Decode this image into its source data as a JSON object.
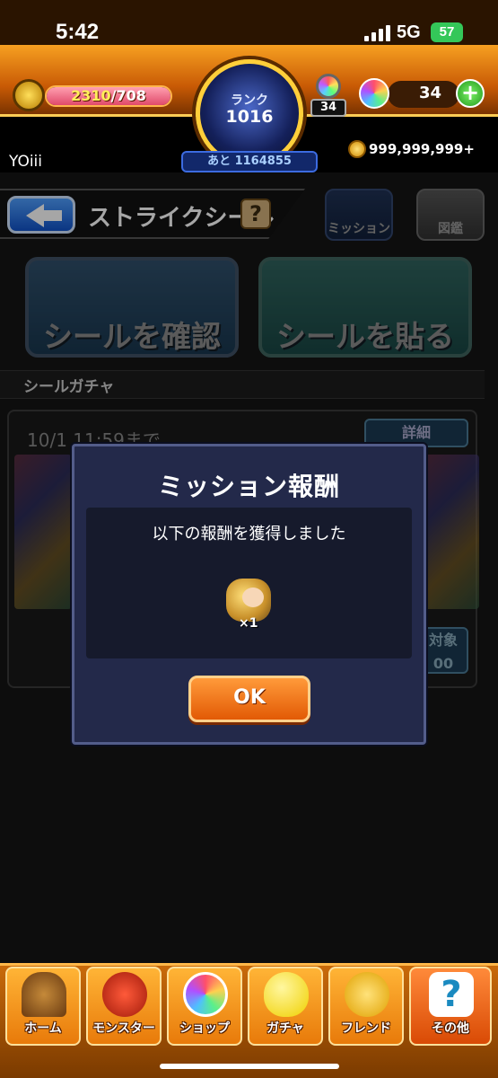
{
  "status_bar": {
    "time": "5:42",
    "network": "5G",
    "battery": "57"
  },
  "header": {
    "stamina": {
      "current": "2310",
      "max": "/708"
    },
    "rank": {
      "label": "ランク",
      "value": "1016",
      "next": "あと 1164855"
    },
    "gacha_count": "34",
    "orbs": "34",
    "plus": "+",
    "username": "YOiii",
    "coins": "999,999,999+"
  },
  "page": {
    "title": "ストライクシール",
    "help": "?",
    "side_buttons": [
      {
        "label": "ミッション",
        "icon": "mission-book-icon"
      },
      {
        "label": "図鑑",
        "icon": "encyclopedia-icon"
      }
    ],
    "sticker_buttons": [
      {
        "label": "シールを確認"
      },
      {
        "label": "シールを貼る"
      }
    ],
    "section": "シールガチャ",
    "gacha": {
      "date": "10/1 11:59まで",
      "detail": "詳細",
      "target": "対象",
      "target_sub": "00"
    }
  },
  "modal": {
    "title": "ミッション報酬",
    "message": "以下の報酬を獲得しました",
    "reward_qty": "×1",
    "ok": "OK"
  },
  "nav": [
    {
      "label": "ホーム",
      "icon": "home-door-icon"
    },
    {
      "label": "モンスター",
      "icon": "monster-dragon-icon"
    },
    {
      "label": "ショップ",
      "icon": "orb-icon"
    },
    {
      "label": "ガチャ",
      "icon": "egg-icon"
    },
    {
      "label": "フレンド",
      "icon": "friends-icon"
    },
    {
      "label": "その他",
      "icon": "question-icon"
    }
  ],
  "colors": {
    "accent": "#f7a021",
    "modal_bg": "#23294a",
    "ok_button": "#e25a05"
  }
}
